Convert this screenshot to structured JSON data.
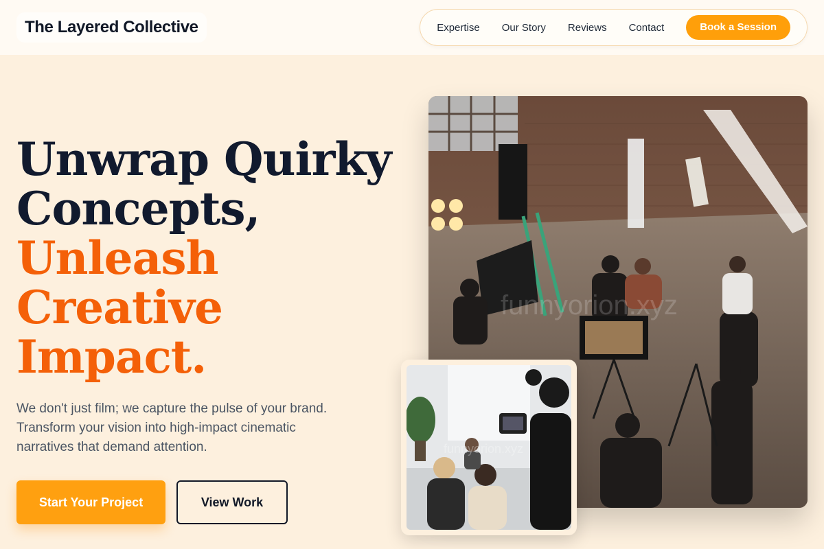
{
  "header": {
    "brand": "The Layered Collective",
    "nav": [
      "Expertise",
      "Our Story",
      "Reviews",
      "Contact"
    ],
    "cta": "Book a Session"
  },
  "hero": {
    "headline_dark_1": "Unwrap Quirky",
    "headline_dark_2": "Concepts,",
    "headline_accent_1": "Unleash",
    "headline_accent_2": "Creative Impact.",
    "lead": "We don't just film; we capture the pulse of your brand. Transform your vision into high-impact cinematic narratives that demand attention.",
    "primary_button": "Start Your Project",
    "secondary_button": "View Work"
  },
  "images": {
    "main_watermark": "funnyorion.xyz",
    "small_watermark": "funnyorion.xyz"
  },
  "colors": {
    "background": "#fdf0de",
    "accent_orange": "#f46008",
    "button_orange": "#ffa010",
    "dark_text": "#111a2e"
  }
}
